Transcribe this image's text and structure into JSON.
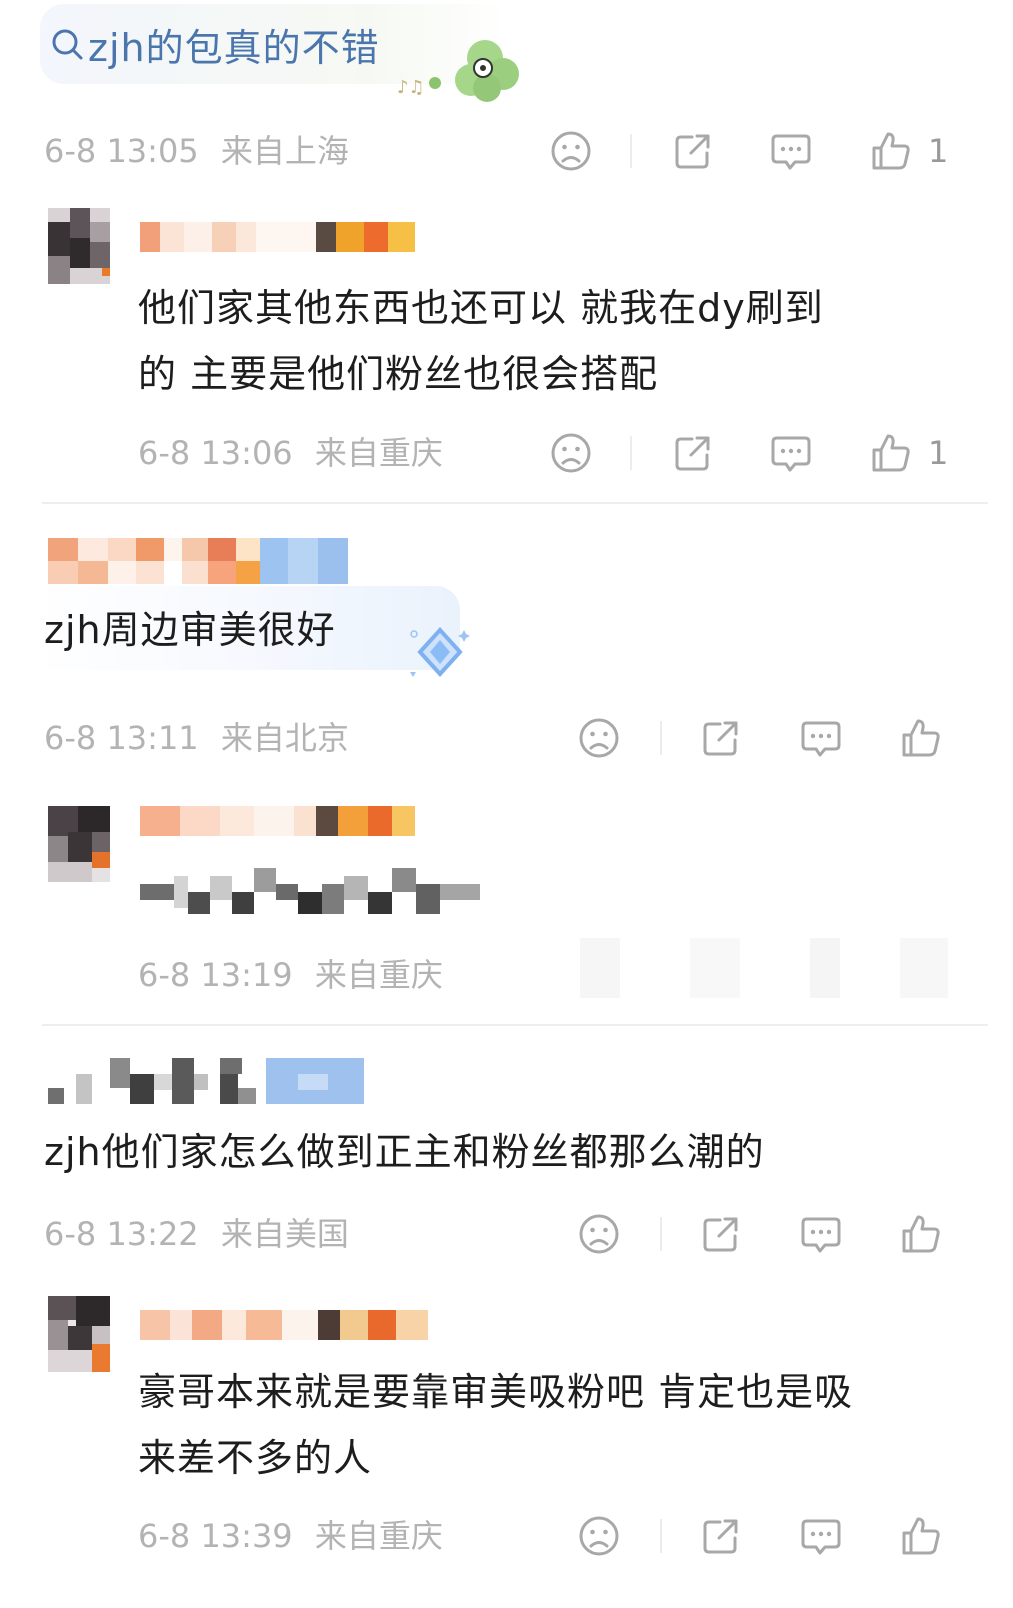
{
  "search": {
    "query": "zjh的包真的不错"
  },
  "comments": [
    {
      "time": "6-8 13:05",
      "location": "来自上海",
      "likes": "1"
    },
    {
      "body": "他们家其他东西也还可以 就我在dy刷到的 主要是他们粉丝也很会搭配",
      "body_line1": "他们家其他东西也还可以 就我在dy刷到",
      "body_line2": "的 主要是他们粉丝也很会搭配",
      "time": "6-8 13:06",
      "location": "来自重庆",
      "likes": "1"
    },
    {
      "body_link": "zjh",
      "body": "周边审美很好",
      "time": "6-8 13:11",
      "location": "来自北京"
    },
    {
      "time": "6-8 13:19",
      "location": "来自重庆"
    },
    {
      "body_link": "zjh",
      "body": "他们家怎么做到正主和粉丝都那么潮的",
      "time": "6-8 13:22",
      "location": "来自美国"
    },
    {
      "body_line1": "豪哥本来就是要靠审美吸粉吧 肯定也是吸",
      "body_line2": "来差不多的人",
      "time": "6-8 13:39",
      "location": "来自重庆"
    }
  ],
  "icons": [
    "search-icon",
    "dislike-icon",
    "share-icon",
    "comment-icon",
    "like-icon",
    "clover-sticker",
    "diamond-badge"
  ],
  "colors": {
    "link": "#4b76ad",
    "meta": "#b3b3b3",
    "text": "#1d1d1d",
    "icon": "#a8a8a8"
  }
}
